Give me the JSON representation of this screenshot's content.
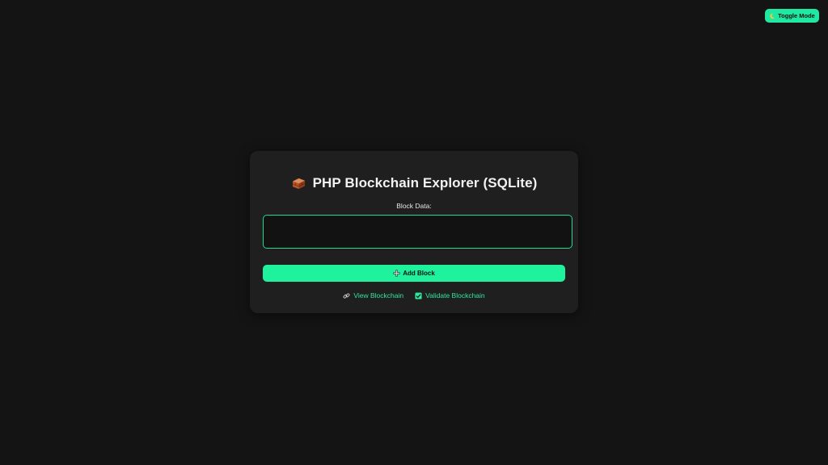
{
  "header": {
    "toggle_label": "Toggle Mode",
    "toggle_icon": "moon-icon"
  },
  "main": {
    "title": "PHP Blockchain Explorer (SQLite)",
    "title_icon": "brick-icon",
    "field_label": "Block Data:",
    "field_value": "",
    "add_button_label": "Add Block",
    "add_button_icon": "plus-icon",
    "links": [
      {
        "label": "View Blockchain",
        "icon": "link-icon"
      },
      {
        "label": "Validate Blockchain",
        "icon": "check-icon"
      }
    ]
  },
  "colors": {
    "background": "#141414",
    "card": "#1f1f1f",
    "accent": "#1ff29d",
    "link": "#2ee89e",
    "text": "#f2f2f2"
  }
}
